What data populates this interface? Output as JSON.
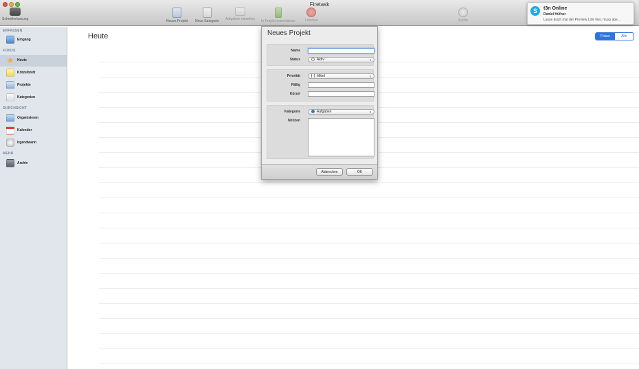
{
  "window": {
    "title": "Firetask"
  },
  "toolbar": {
    "items": [
      {
        "label": "Schnellerfassung",
        "icon": "quick-entry-icon"
      },
      {
        "label": "Neues Projekt",
        "icon": "new-project-icon"
      },
      {
        "label": "Neue Kategorie",
        "icon": "new-category-icon"
      },
      {
        "label": "Aufgaben einsehen",
        "icon": "view-tasks-icon"
      },
      {
        "label": "In Projekt konvertieren",
        "icon": "convert-project-icon"
      },
      {
        "label": "Löschen",
        "icon": "delete-icon"
      },
      {
        "label": "Suche",
        "icon": "search-icon"
      }
    ]
  },
  "sidebar": {
    "sections": [
      "ERFASSEN",
      "FOKUS",
      "DURCHSICHT",
      "MEHR"
    ],
    "items": [
      {
        "label": "Eingang",
        "icon": "inbox-icon"
      },
      {
        "label": "Heute",
        "icon": "star-icon"
      },
      {
        "label": "Kritzelbrett",
        "icon": "notepad-icon"
      },
      {
        "label": "Projekte",
        "icon": "projects-icon"
      },
      {
        "label": "Kategorien",
        "icon": "folder-icon"
      },
      {
        "label": "Organisieren",
        "icon": "organize-icon"
      },
      {
        "label": "Kalender",
        "icon": "calendar-icon"
      },
      {
        "label": "Irgendwann",
        "icon": "someday-icon"
      },
      {
        "label": "Archiv",
        "icon": "archive-icon"
      }
    ],
    "active_item": "Heute"
  },
  "main": {
    "title": "Heute",
    "filter": {
      "options": [
        "Fokus",
        "Alle"
      ],
      "selected": "Fokus"
    }
  },
  "dialog": {
    "title": "Neues Projekt",
    "fields": {
      "name_label": "Name",
      "name_value": "",
      "status_label": "Status",
      "status_value": "Aktiv",
      "priority_label": "Priorität",
      "priority_value": "Mittel",
      "due_label": "Fällig",
      "due_value": "",
      "short_label": "Kürzel",
      "short_value": "",
      "category_label": "Kategorie",
      "category_value": "Aufgaben",
      "notes_label": "Notizen",
      "notes_value": ""
    },
    "buttons": {
      "cancel": "Abbrechen",
      "ok": "OK"
    }
  },
  "notification": {
    "app": "t3n Online",
    "sender": "Daniel Hüfner",
    "message": "Lasse Euch mal der Preview Link hier, muss abe..."
  },
  "colors": {
    "accent": "#2f74dc",
    "sidebar_bg": "#e1e6ec",
    "sidebar_active": "#c9d1db",
    "skype_blue": "#20a8e8"
  }
}
